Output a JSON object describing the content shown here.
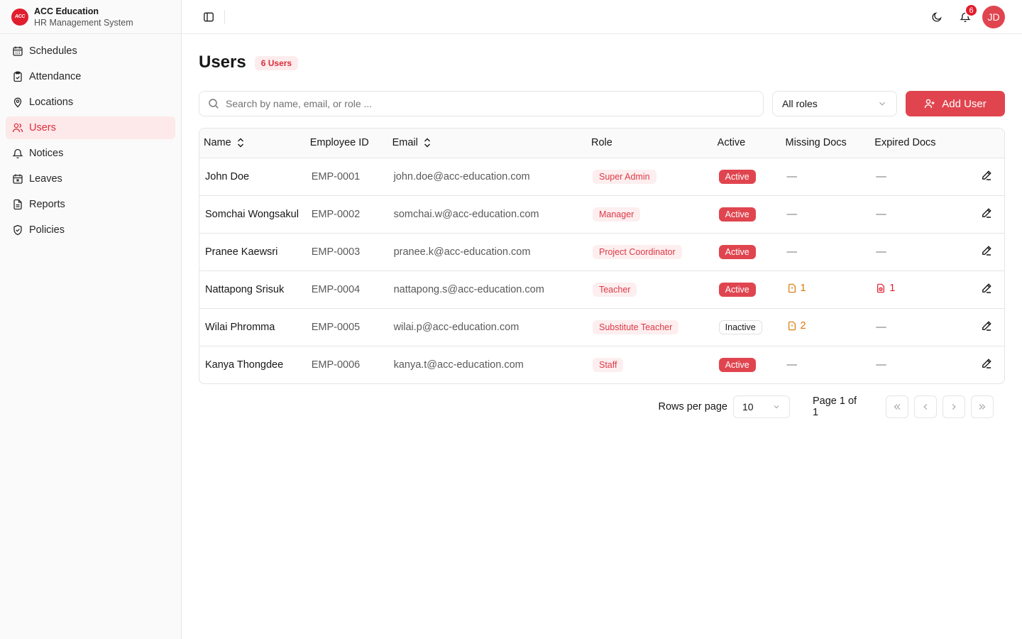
{
  "brand": {
    "logo_text": "ACC",
    "title": "ACC Education",
    "subtitle": "HR Management System"
  },
  "sidebar": {
    "items": [
      {
        "label": "Schedules",
        "icon": "calendar-icon",
        "active": false
      },
      {
        "label": "Attendance",
        "icon": "clipboard-check-icon",
        "active": false
      },
      {
        "label": "Locations",
        "icon": "map-pin-icon",
        "active": false
      },
      {
        "label": "Users",
        "icon": "users-icon",
        "active": true
      },
      {
        "label": "Notices",
        "icon": "bell-icon",
        "active": false
      },
      {
        "label": "Leaves",
        "icon": "calendar-x-icon",
        "active": false
      },
      {
        "label": "Reports",
        "icon": "file-text-icon",
        "active": false
      },
      {
        "label": "Policies",
        "icon": "shield-check-icon",
        "active": false
      }
    ]
  },
  "topbar": {
    "notification_count": "6",
    "avatar_initials": "JD"
  },
  "page": {
    "title": "Users",
    "count_label": "6 Users"
  },
  "toolbar": {
    "search_placeholder": "Search by name, email, or role ...",
    "role_filter": "All roles",
    "add_label": "Add User"
  },
  "table": {
    "headers": {
      "name": "Name",
      "employee_id": "Employee ID",
      "email": "Email",
      "role": "Role",
      "active": "Active",
      "missing_docs": "Missing Docs",
      "expired_docs": "Expired Docs"
    },
    "rows": [
      {
        "name": "John Doe",
        "employee_id": "EMP-0001",
        "email": "john.doe@acc-education.com",
        "role": "Super Admin",
        "status": "Active",
        "missing_docs": "—",
        "expired_docs": "—"
      },
      {
        "name": "Somchai Wongsakul",
        "employee_id": "EMP-0002",
        "email": "somchai.w@acc-education.com",
        "role": "Manager",
        "status": "Active",
        "missing_docs": "—",
        "expired_docs": "—"
      },
      {
        "name": "Pranee Kaewsri",
        "employee_id": "EMP-0003",
        "email": "pranee.k@acc-education.com",
        "role": "Project Coordinator",
        "status": "Active",
        "missing_docs": "—",
        "expired_docs": "—"
      },
      {
        "name": "Nattapong Srisuk",
        "employee_id": "EMP-0004",
        "email": "nattapong.s@acc-education.com",
        "role": "Teacher",
        "status": "Active",
        "missing_docs": "1",
        "expired_docs": "1"
      },
      {
        "name": "Wilai Phromma",
        "employee_id": "EMP-0005",
        "email": "wilai.p@acc-education.com",
        "role": "Substitute Teacher",
        "status": "Inactive",
        "missing_docs": "2",
        "expired_docs": "—"
      },
      {
        "name": "Kanya Thongdee",
        "employee_id": "EMP-0006",
        "email": "kanya.t@acc-education.com",
        "role": "Staff",
        "status": "Active",
        "missing_docs": "—",
        "expired_docs": "—"
      }
    ]
  },
  "pagination": {
    "rows_label": "Rows per page",
    "rows_value": "10",
    "page_info": "Page 1 of 1"
  },
  "colors": {
    "accent": "#e0454f",
    "accent_soft": "#fde8ea",
    "warning": "#d97706",
    "danger": "#e11d2e"
  }
}
